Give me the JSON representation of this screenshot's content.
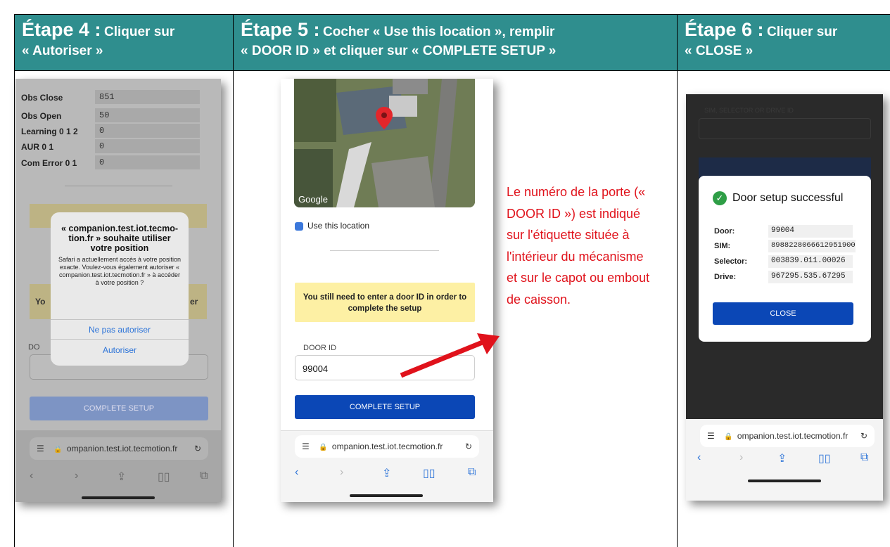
{
  "col1": {
    "h_big": "Étape 4 :",
    "h_small": "Cliquer sur",
    "h_l2": "« Autoriser »",
    "phone": {
      "rows": [
        {
          "label": "Obs Close",
          "value": "851"
        },
        {
          "label": "Obs Open",
          "value": "50"
        },
        {
          "label": "Learning 0 1 2",
          "value": "0"
        },
        {
          "label": "AUR 0 1",
          "value": "0"
        },
        {
          "label": "Com Error 0 1",
          "value": "0"
        }
      ],
      "bg_left": "Yo",
      "bg_right": "er",
      "door_label": "DO",
      "dialog_title": "« companion.test.iot.tecmo-tion.fr » souhaite utiliser votre position",
      "dialog_desc": "Safari a actuellement accès à votre position exacte. Voulez-vous également autoriser « companion.test.iot.tecmotion.fr » à accéder à votre position ?",
      "deny": "Ne pas autoriser",
      "allow": "Autoriser",
      "complete": "COMPLETE SETUP",
      "url": "ompanion.test.iot.tecmotion.fr"
    }
  },
  "col2": {
    "h_big": "Étape 5 :",
    "h_small": "Cocher « Use this location », remplir",
    "h_l2": "« DOOR ID » et cliquer sur « COMPLETE SETUP »",
    "phone": {
      "google": "Google",
      "use_location": "Use this location",
      "notice": "You still need to enter a door ID in order to complete the setup",
      "door_label": "DOOR ID",
      "door_value": "99004",
      "complete": "COMPLETE SETUP",
      "url": "ompanion.test.iot.tecmotion.fr"
    },
    "note": "Le numéro de la porte (« DOOR ID ») est indiqué sur l'étiquette située à l'intérieur du mécanisme et sur le capot ou embout de caisson."
  },
  "col3": {
    "h_big": "Étape 6 :",
    "h_small": "Cliquer sur",
    "h_l2": "« CLOSE »",
    "phone": {
      "bg_label": "SIM, SELECTOR OR DRIVE ID",
      "title": "Door setup successful",
      "rows": [
        {
          "label": "Door:",
          "value": "99004"
        },
        {
          "label": "SIM:",
          "value": "8988228066612951900"
        },
        {
          "label": "Selector:",
          "value": "003839.011.00026"
        },
        {
          "label": "Drive:",
          "value": "967295.535.67295"
        }
      ],
      "close": "CLOSE",
      "url": "ompanion.test.iot.tecmotion.fr"
    }
  },
  "colors": {
    "header": "#2f8e8e",
    "note": "#e0121b",
    "button": "#0b47b6"
  }
}
